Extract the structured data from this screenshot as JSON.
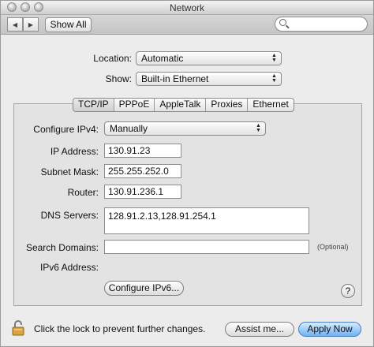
{
  "window": {
    "title": "Network"
  },
  "toolbar": {
    "show_all_label": "Show All",
    "back_glyph": "◀",
    "forward_glyph": "▶",
    "search_placeholder": ""
  },
  "location": {
    "label": "Location:",
    "value": "Automatic"
  },
  "show": {
    "label": "Show:",
    "value": "Built-in Ethernet"
  },
  "tabs": [
    {
      "label": "TCP/IP",
      "selected": true
    },
    {
      "label": "PPPoE",
      "selected": false
    },
    {
      "label": "AppleTalk",
      "selected": false
    },
    {
      "label": "Proxies",
      "selected": false
    },
    {
      "label": "Ethernet",
      "selected": false
    }
  ],
  "tcpip": {
    "configure_ipv4": {
      "label": "Configure IPv4:",
      "value": "Manually"
    },
    "ip_address": {
      "label": "IP Address:",
      "value": "130.91.23"
    },
    "subnet_mask": {
      "label": "Subnet Mask:",
      "value": "255.255.252.0"
    },
    "router": {
      "label": "Router:",
      "value": "130.91.236.1"
    },
    "dns_servers": {
      "label": "DNS Servers:",
      "value": "128.91.2.13,128.91.254.1"
    },
    "search_domains": {
      "label": "Search Domains:",
      "value": "",
      "hint": "(Optional)"
    },
    "ipv6_address": {
      "label": "IPv6 Address:"
    },
    "configure_ipv6_button": "Configure IPv6...",
    "help_glyph": "?"
  },
  "footer": {
    "lock_text": "Click the lock to prevent further changes.",
    "assist_button": "Assist me...",
    "apply_button": "Apply Now"
  }
}
